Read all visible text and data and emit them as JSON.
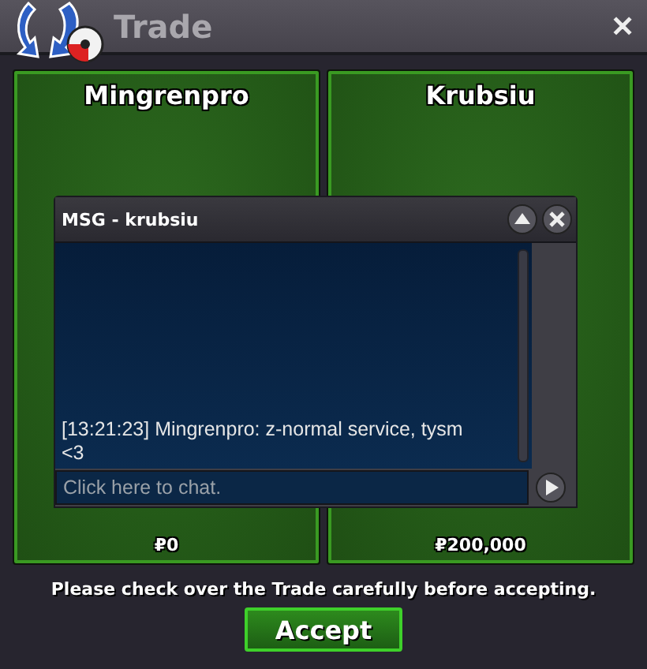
{
  "window": {
    "title": "Trade",
    "close": "✕"
  },
  "traders": [
    {
      "name": "Mingrenpro",
      "money": "₽0"
    },
    {
      "name": "Krubsiu",
      "money": "₽200,000"
    }
  ],
  "chat": {
    "title": "MSG - krubsiu",
    "messages": [
      "[13:21:23] Mingrenpro: z-normal service, tysm <3"
    ],
    "placeholder": "Click here to chat."
  },
  "notice": "Please check over the Trade carefully before accepting.",
  "accept_button": "Accept"
}
